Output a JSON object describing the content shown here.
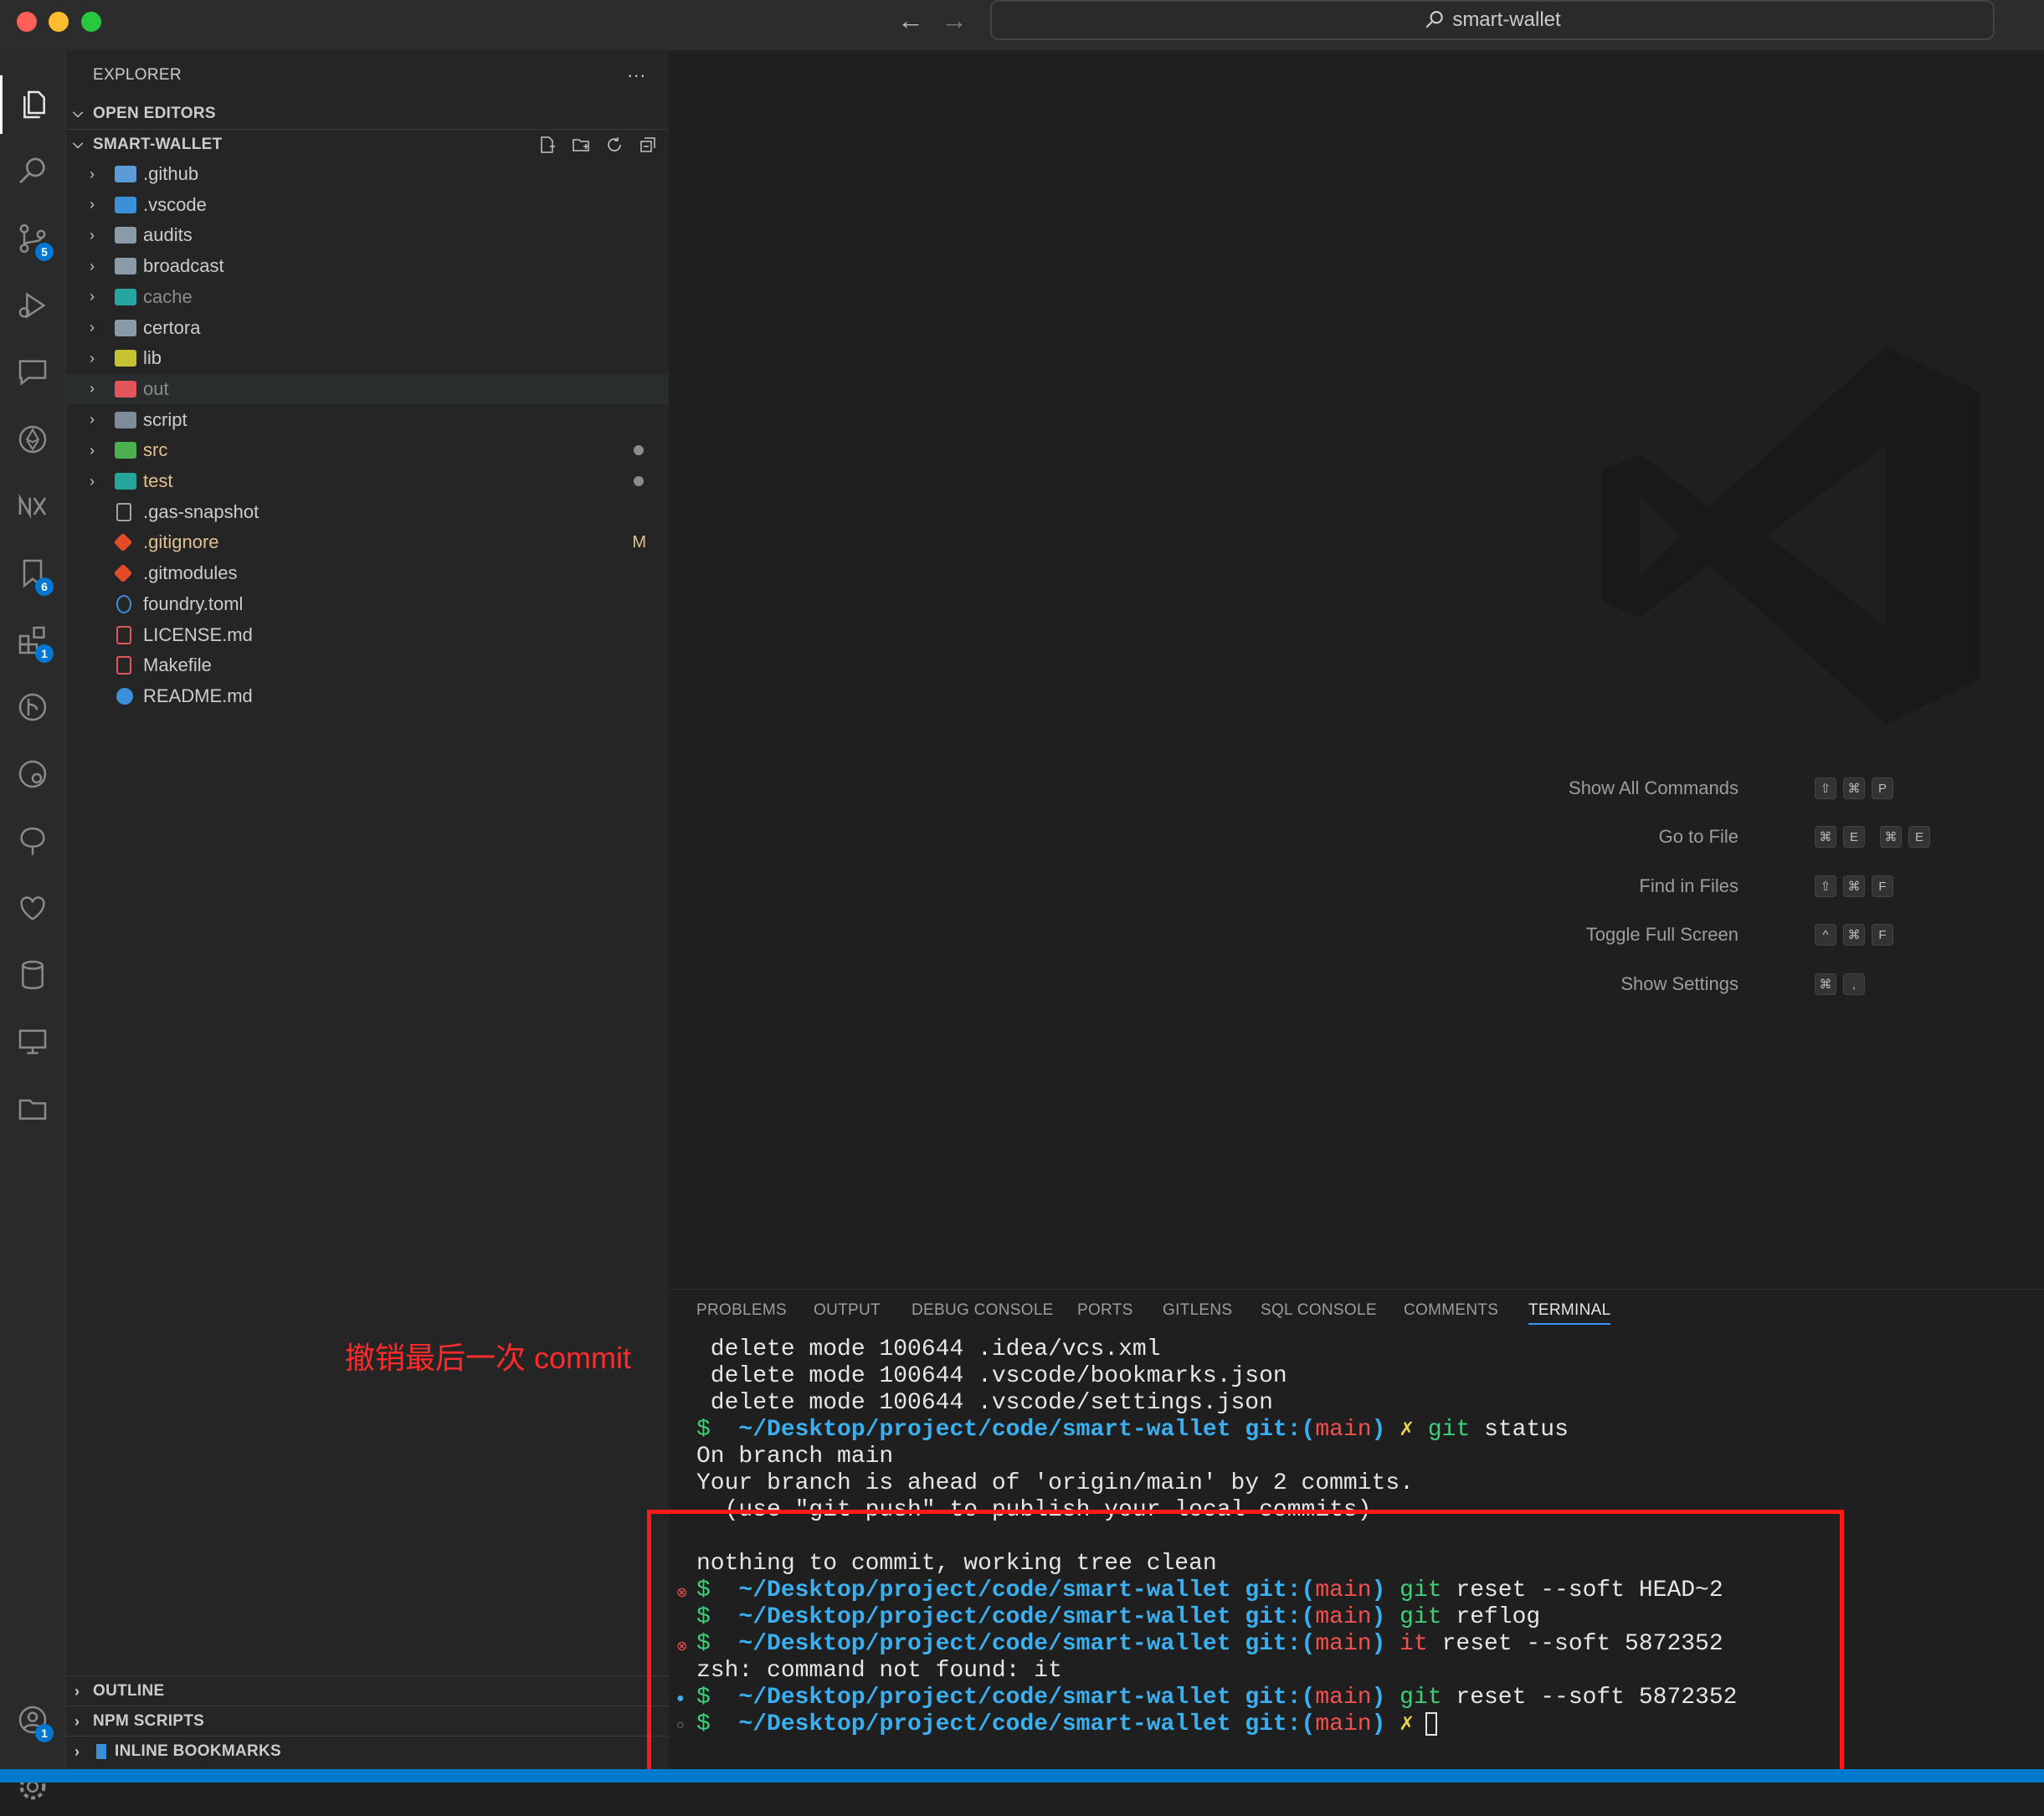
{
  "window": {
    "title": "smart-wallet"
  },
  "explorer": {
    "header": "EXPLORER",
    "more": "···",
    "open_editors": "OPEN EDITORS",
    "project": "SMART-WALLET",
    "items": [
      {
        "name": ".github",
        "type": "folder",
        "color": "#5c9bd6"
      },
      {
        "name": ".vscode",
        "type": "folder",
        "color": "#3b8ed8"
      },
      {
        "name": "audits",
        "type": "folder",
        "color": "#8a9aa9"
      },
      {
        "name": "broadcast",
        "type": "folder",
        "color": "#8a9aa9"
      },
      {
        "name": "cache",
        "type": "folder",
        "color": "#26a6a0"
      },
      {
        "name": "certora",
        "type": "folder",
        "color": "#8a9aa9"
      },
      {
        "name": "lib",
        "type": "folder",
        "color": "#c7c232"
      },
      {
        "name": "out",
        "type": "folder",
        "color": "#e0565b"
      },
      {
        "name": "script",
        "type": "folder",
        "color": "#7e8c99"
      },
      {
        "name": "src",
        "type": "folder",
        "color": "#4caf50"
      },
      {
        "name": "test",
        "type": "folder",
        "color": "#26a69a"
      },
      {
        "name": ".gas-snapshot",
        "type": "file"
      },
      {
        "name": ".gitignore",
        "type": "file",
        "status": "M"
      },
      {
        "name": ".gitmodules",
        "type": "file"
      },
      {
        "name": "foundry.toml",
        "type": "file"
      },
      {
        "name": "LICENSE.md",
        "type": "file"
      },
      {
        "name": "Makefile",
        "type": "file"
      },
      {
        "name": "README.md",
        "type": "file"
      }
    ],
    "outline": "OUTLINE",
    "npm_scripts": "NPM SCRIPTS",
    "inline_bookmarks": "INLINE BOOKMARKS"
  },
  "activity_badges": {
    "source_control": "5",
    "bookmarks": "6",
    "extensions": "1",
    "accounts": "1"
  },
  "annotation": "撤销最后一次 commit",
  "welcome": {
    "commands": [
      {
        "label": "Show All Commands",
        "keys": [
          "⇧",
          "⌘",
          "P"
        ]
      },
      {
        "label": "Go to File",
        "keys": [
          "⌘",
          "E",
          "⌘",
          "E"
        ]
      },
      {
        "label": "Find in Files",
        "keys": [
          "⇧",
          "⌘",
          "F"
        ]
      },
      {
        "label": "Toggle Full Screen",
        "keys": [
          "^",
          "⌘",
          "F"
        ]
      },
      {
        "label": "Show Settings",
        "keys": [
          "⌘",
          ","
        ]
      }
    ]
  },
  "panel": {
    "tabs": [
      "PROBLEMS",
      "OUTPUT",
      "DEBUG CONSOLE",
      "PORTS",
      "GITLENS",
      "SQL CONSOLE",
      "COMMENTS",
      "TERMINAL"
    ],
    "active_tab": "TERMINAL"
  },
  "terminal": {
    "prompt_path": "~/Desktop/project/code/smart-wallet",
    "git_label": "git:",
    "branch": "main",
    "lines": {
      "l1": " delete mode 100644 .idea/vcs.xml",
      "l2": " delete mode 100644 .vscode/bookmarks.json",
      "l3": " delete mode 100644 .vscode/settings.json",
      "l4_cmd": "git",
      "l4_args": " status",
      "l5": "On branch main",
      "l6": "Your branch is ahead of 'origin/main' by 2 commits.",
      "l7": "  (use \"git push\" to publish your local commits)",
      "l8": "nothing to commit, working tree clean",
      "l9_cmd": "git",
      "l9_args": " reset --soft HEAD~2",
      "l10_cmd": "git",
      "l10_args": " reflog",
      "l11_cmd": "it",
      "l11_args": " reset --soft 5872352",
      "l12": "zsh: command not found: it",
      "l13_cmd": "git",
      "l13_args": " reset --soft 5872352"
    }
  }
}
